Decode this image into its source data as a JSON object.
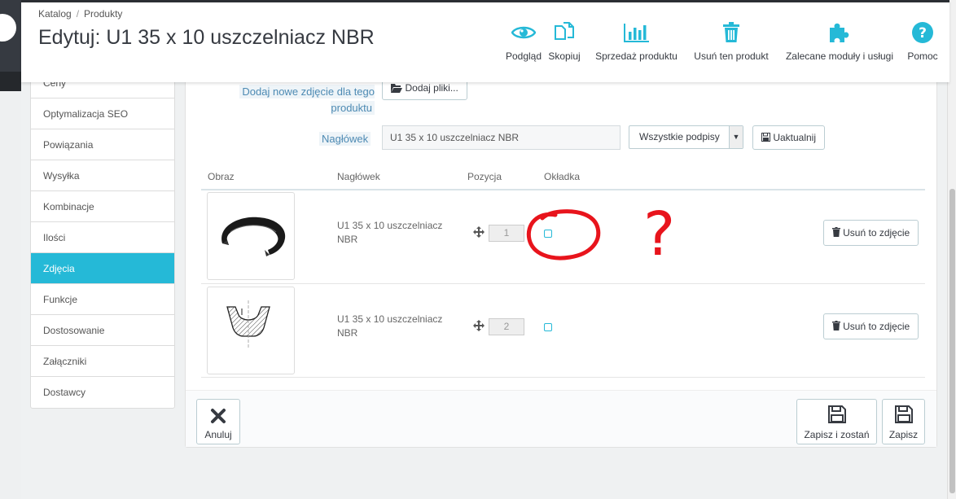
{
  "breadcrumb": {
    "catalog": "Katalog",
    "separator": "/",
    "products": "Produkty"
  },
  "page_title": "Edytuj: U1 35 x 10 uszczelniacz NBR",
  "toolbar": {
    "preview": "Podgląd",
    "copy": "Skopiuj",
    "sales": "Sprzedaż produktu",
    "delete": "Usuń ten produkt",
    "modules": "Zalecane moduły i usługi",
    "help": "Pomoc"
  },
  "sidebar": {
    "items": [
      {
        "label": "Ceny"
      },
      {
        "label": "Optymalizacja SEO"
      },
      {
        "label": "Powiązania"
      },
      {
        "label": "Wysyłka"
      },
      {
        "label": "Kombinacje"
      },
      {
        "label": "Ilości"
      },
      {
        "label": "Zdjęcia",
        "active": true
      },
      {
        "label": "Funkcje"
      },
      {
        "label": "Dostosowanie"
      },
      {
        "label": "Załączniki"
      },
      {
        "label": "Dostawcy"
      }
    ]
  },
  "images_form": {
    "add_photo_label": "Dodaj nowe zdjęcie dla tego produktu",
    "add_files_button": "Dodaj pliki...",
    "caption_label": "Nagłówek",
    "caption_value": "U1 35 x 10  uszczelniacz NBR",
    "caption_select": "Wszystkie podpisy",
    "update_button": "Uaktualnij"
  },
  "table": {
    "headers": {
      "image": "Obraz",
      "caption": "Nagłówek",
      "position": "Pozycja",
      "cover": "Okładka"
    },
    "rows": [
      {
        "caption": "U1 35 x 10 uszczelniacz NBR",
        "position": "1",
        "cover": false,
        "delete_label": "Usuń to zdjęcie"
      },
      {
        "caption": "U1 35 x 10 uszczelniacz NBR",
        "position": "2",
        "cover": false,
        "delete_label": "Usuń to zdjęcie"
      }
    ]
  },
  "footer": {
    "cancel": "Anuluj",
    "save_stay": "Zapisz i zostań",
    "save": "Zapisz"
  },
  "annotation": {
    "mark": "?",
    "color": "#e8141c"
  },
  "colors": {
    "accent": "#25b9d7",
    "label_blue": "#4d8ab3",
    "dark": "#363a41"
  }
}
